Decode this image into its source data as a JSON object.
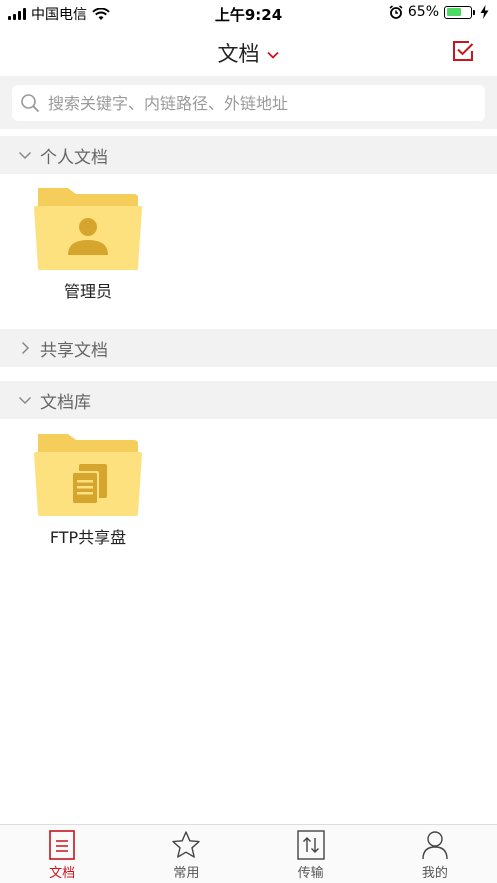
{
  "status_bar": {
    "carrier": "中国电信",
    "time": "上午9:24",
    "battery_percent": "65%",
    "battery_level": 0.65,
    "icons": [
      "signal-icon",
      "wifi-icon",
      "alarm-icon",
      "battery-icon",
      "charging-icon"
    ]
  },
  "nav": {
    "title": "文档",
    "title_icon": "chevron-down-icon",
    "right_icon": "checkbox-icon",
    "accent": "#c9151e"
  },
  "search": {
    "placeholder": "搜索关键字、内链路径、外链地址",
    "icon": "search-icon"
  },
  "sections": [
    {
      "label": "个人文档",
      "expanded": true,
      "items": [
        {
          "label": "管理员",
          "icon": "user-folder-icon"
        }
      ]
    },
    {
      "label": "共享文档",
      "expanded": false,
      "items": []
    },
    {
      "label": "文档库",
      "expanded": true,
      "items": [
        {
          "label": "FTP共享盘",
          "icon": "document-folder-icon"
        }
      ]
    }
  ],
  "tabs": [
    {
      "label": "文档",
      "icon": "document-icon",
      "active": true
    },
    {
      "label": "常用",
      "icon": "star-icon",
      "active": false
    },
    {
      "label": "传输",
      "icon": "transfer-icon",
      "active": false
    },
    {
      "label": "我的",
      "icon": "person-icon",
      "active": false
    }
  ],
  "colors": {
    "accent": "#c9151e",
    "folder_back": "#f5cd5a",
    "folder_front": "#fde17f",
    "folder_glyph": "#d5a52d",
    "section_bg": "#f2f2f2"
  }
}
